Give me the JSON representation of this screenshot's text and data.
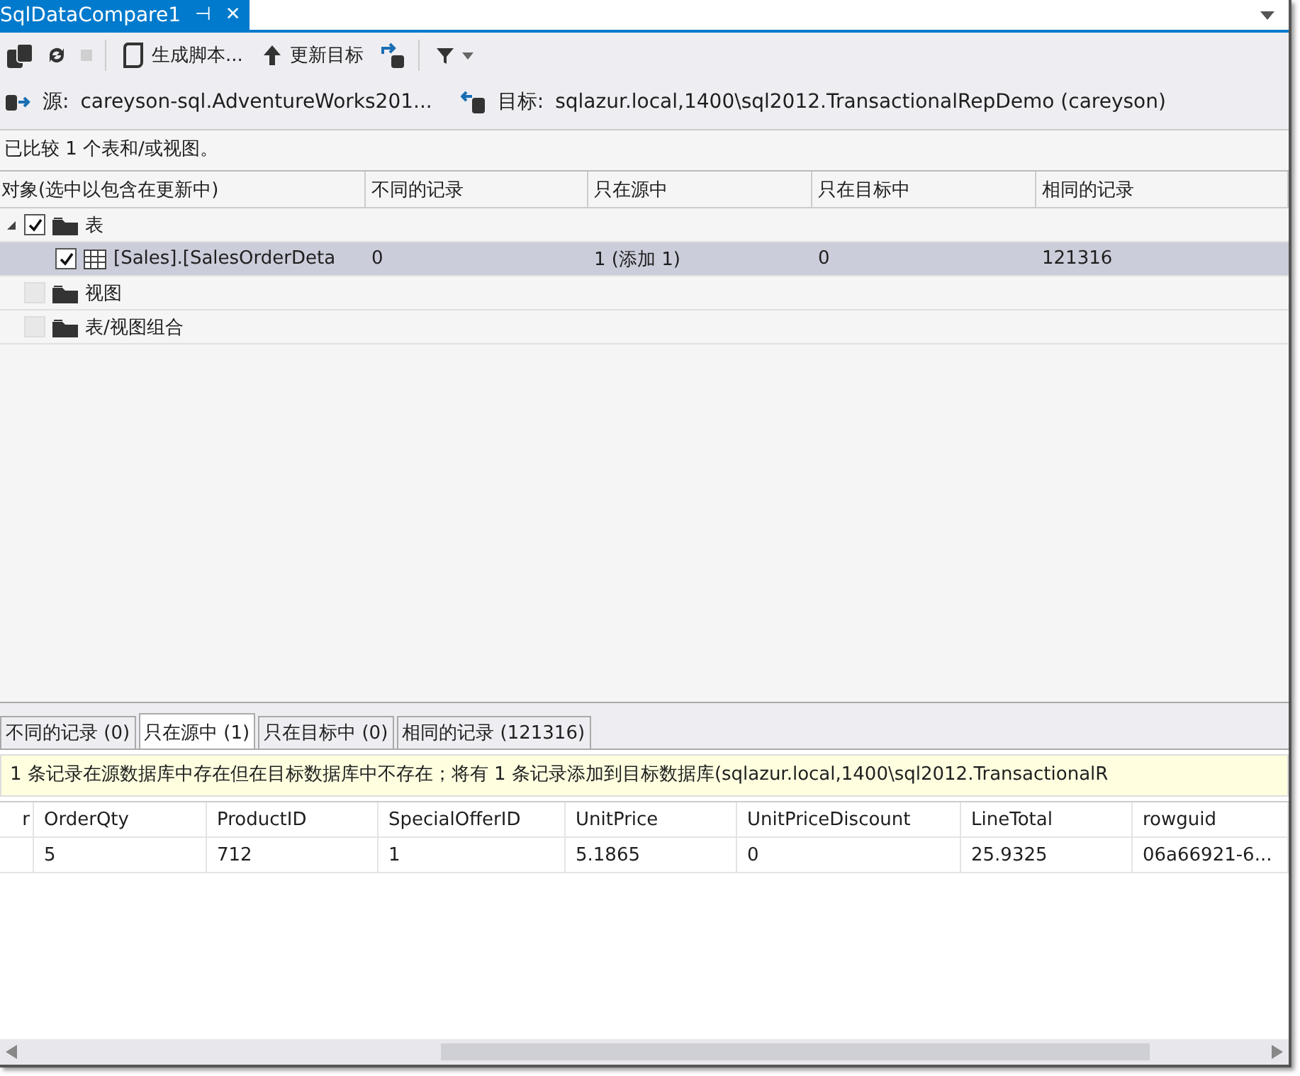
{
  "document_tab": {
    "title": "SqlDataCompare1",
    "pin": "⊣",
    "close": "✕"
  },
  "toolbar": {
    "items": [
      {
        "kind": "icon",
        "disabled": false
      },
      {
        "kind": "icon",
        "disabled": false
      },
      {
        "kind": "icon",
        "disabled": true
      },
      {
        "kind": "separator"
      },
      {
        "kind": "button",
        "label": "生成脚本..."
      },
      {
        "kind": "button",
        "label": "更新目标"
      },
      {
        "kind": "icon",
        "disabled": false
      },
      {
        "kind": "separator"
      },
      {
        "kind": "dropdown"
      }
    ]
  },
  "connection": {
    "source_label": "源:",
    "source": "careyson-sql.AdventureWorks201...",
    "target_label": "目标:",
    "target": "sqlazur.local,1400\\sql2012.TransactionalRepDemo (careyson)"
  },
  "summary": "已比较 1 个表和/或视图。",
  "objects_grid": {
    "columns": [
      "对象(选中以包含在更新中)",
      "不同的记录",
      "只在源中",
      "只在目标中",
      "相同的记录"
    ],
    "rows": [
      {
        "label": "表",
        "expanded": true,
        "checked": true,
        "enabled": true,
        "selected": false,
        "children": [
          {
            "label": "[Sales].[SalesOrderDeta",
            "checked": true,
            "enabled": true,
            "selected": true,
            "cells": [
              "0",
              "1 (添加 1)",
              "0",
              "121316"
            ]
          }
        ]
      },
      {
        "label": "视图",
        "checked": false,
        "enabled": false,
        "selected": false
      },
      {
        "label": "表/视图组合",
        "checked": false,
        "enabled": false,
        "selected": false
      }
    ]
  },
  "detail_tabs": [
    {
      "label": "不同的记录 (0)",
      "selected": false
    },
    {
      "label": "只在源中 (1)",
      "selected": true
    },
    {
      "label": "只在目标中 (0)",
      "selected": false
    },
    {
      "label": "相同的记录 (121316)",
      "selected": false
    }
  ],
  "info_message": "1 条记录在源数据库中存在但在目标数据库中不存在；将有 1 条记录添加到目标数据库(sqlazur.local,1400\\sql2012.TransactionalR",
  "records_grid": {
    "columns": [
      "r",
      "OrderQty",
      "ProductID",
      "SpecialOfferID",
      "UnitPrice",
      "UnitPriceDiscount",
      "LineTotal",
      "rowguid"
    ],
    "rows": [
      {
        "cells": [
          "",
          "5",
          "712",
          "1",
          "5.1865",
          "0",
          "25.9325",
          "06a66921-6..."
        ]
      }
    ]
  }
}
